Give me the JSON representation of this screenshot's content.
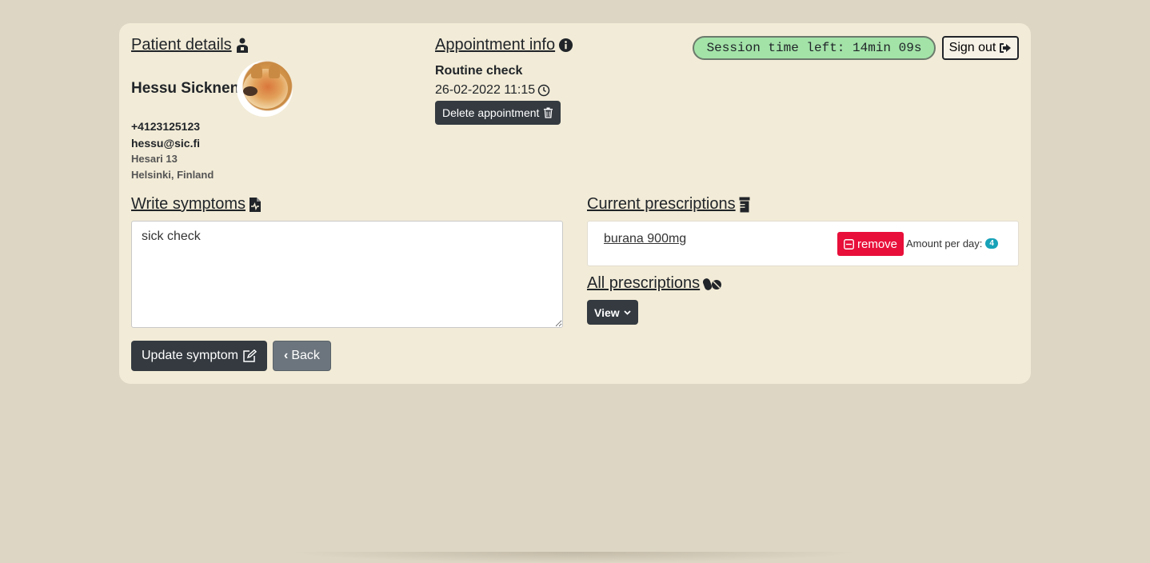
{
  "patient": {
    "section_title": "Patient details",
    "name": "Hessu Sicknen",
    "phone": "+4123125123",
    "email": "hessu@sic.fi",
    "address_line1": "Hesari 13",
    "address_line2": "Helsinki, Finland"
  },
  "appointment": {
    "section_title": "Appointment info",
    "type": "Routine check",
    "datetime": "26-02-2022 11:15",
    "delete_label": "Delete appointment"
  },
  "session": {
    "time_left": "Session time left: 14min 09s",
    "sign_out_label": "Sign out"
  },
  "symptoms": {
    "section_title": "Write symptoms",
    "text": "sick check",
    "update_label": "Update symptom",
    "back_label": "Back"
  },
  "prescriptions": {
    "current_title": "Current prescriptions",
    "items": [
      {
        "name": "burana 900mg",
        "remove_label": "remove",
        "amount_label": "Amount per day:",
        "amount": "4"
      }
    ],
    "all_title": "All prescriptions",
    "view_label": "View"
  },
  "colors": {
    "page_bg": "#ddd6c4",
    "card_bg": "#f2ebd7",
    "dark_button": "#343a40",
    "remove_button": "#e8103a",
    "session_bg": "#a3e3a8",
    "badge": "#17a2b8"
  }
}
